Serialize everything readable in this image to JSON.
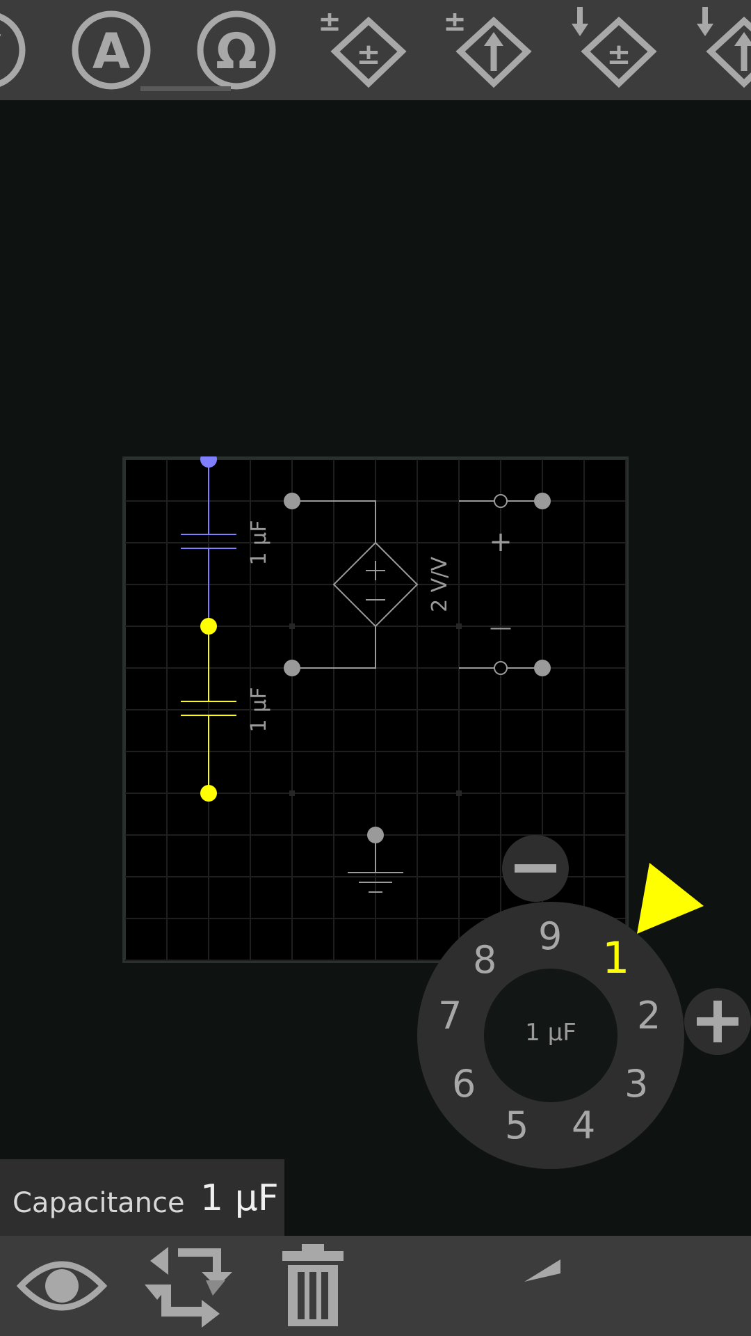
{
  "toolbar": {
    "tools": [
      {
        "name": "voltmeter-tool",
        "icon": "voltmeter-icon",
        "glyph": "V",
        "selected": false
      },
      {
        "name": "ammeter-tool",
        "icon": "ammeter-icon",
        "glyph": "A",
        "selected": false
      },
      {
        "name": "ohmmeter-tool",
        "icon": "ohmmeter-icon",
        "glyph": "Ω",
        "selected": true
      },
      {
        "name": "vcvs-tool",
        "icon": "voltage-controlled-voltage-source-icon",
        "selected": false
      },
      {
        "name": "vccs-tool",
        "icon": "voltage-controlled-current-source-icon",
        "selected": false
      },
      {
        "name": "ccvs-tool",
        "icon": "current-controlled-voltage-source-icon",
        "selected": false
      },
      {
        "name": "cccs-tool",
        "icon": "current-controlled-current-source-icon",
        "selected": false
      }
    ]
  },
  "schematic": {
    "capacitor_top_label": "1 µF",
    "capacitor_bottom_label": "1 µF",
    "source_gain_label": "2 V/V",
    "plus_sign": "+",
    "minus_sign": "—"
  },
  "colors": {
    "selected_node": "#ffff00",
    "other_node": "#8080ff",
    "wire_gray": "#9a9a9a",
    "grid": "#1f1f1f",
    "toolbar_bg": "#3c3c3c",
    "icon_gray": "#a8a8a8"
  },
  "dial": {
    "numbers": [
      "9",
      "1",
      "2",
      "3",
      "4",
      "5",
      "6",
      "7",
      "8"
    ],
    "selected": "1",
    "center_label": "1 µF",
    "minus_icon": "minus-icon",
    "plus_icon": "plus-icon"
  },
  "property": {
    "name": "Capacitance",
    "value": "1 µF"
  },
  "bottombar": {
    "icons": [
      "eye-icon",
      "rotate-icon",
      "trash-icon",
      "undo-icon"
    ]
  }
}
